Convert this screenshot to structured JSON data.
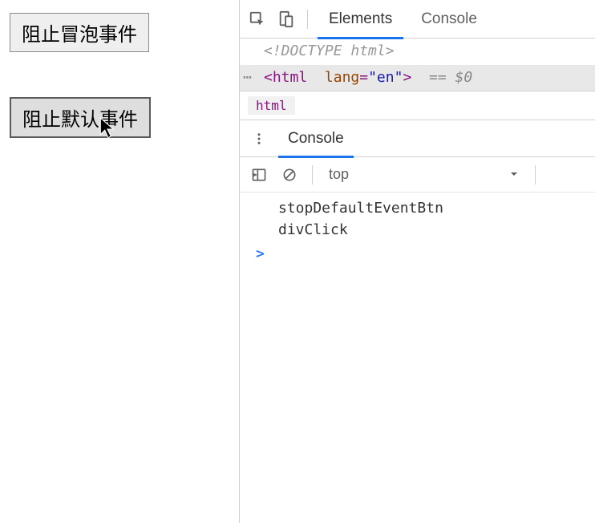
{
  "page": {
    "buttons": [
      {
        "label": "阻止冒泡事件",
        "pressed": false
      },
      {
        "label": "阻止默认事件",
        "pressed": true
      }
    ]
  },
  "devtools": {
    "tabs": [
      {
        "label": "Elements",
        "active": true
      },
      {
        "label": "Console",
        "active": false
      }
    ],
    "elements": {
      "doctype": "<!DOCTYPE html>",
      "selected": {
        "tag": "html",
        "attr_name": "lang",
        "attr_value": "\"en\"",
        "selector_hint": "== $0"
      }
    },
    "breadcrumb": [
      "html"
    ],
    "drawer": {
      "tabs": [
        {
          "label": "Console",
          "active": true
        }
      ],
      "context": "top",
      "logs": [
        "stopDefaultEventBtn",
        "divClick"
      ],
      "prompt": ">"
    }
  }
}
